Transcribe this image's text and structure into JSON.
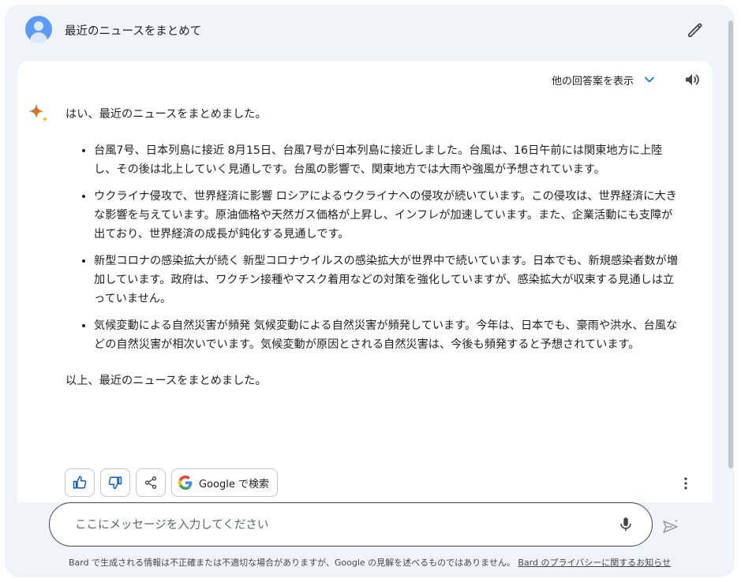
{
  "query": {
    "text": "最近のニュースをまとめて"
  },
  "response": {
    "drafts_label": "他の回答案を表示",
    "intro": "はい、最近のニュースをまとめました。",
    "bullets": [
      "台風7号、日本列島に接近 8月15日、台風7号が日本列島に接近しました。台風は、16日午前には関東地方に上陸し、その後は北上していく見通しです。台風の影響で、関東地方では大雨や強風が予想されています。",
      "ウクライナ侵攻で、世界経済に影響 ロシアによるウクライナへの侵攻が続いています。この侵攻は、世界経済に大きな影響を与えています。原油価格や天然ガス価格が上昇し、インフレが加速しています。また、企業活動にも支障が出ており、世界経済の成長が鈍化する見通しです。",
      "新型コロナの感染拡大が続く 新型コロナウイルスの感染拡大が世界中で続いています。日本でも、新規感染者数が増加しています。政府は、ワクチン接種やマスク着用などの対策を強化していますが、感染拡大が収束する見通しは立っていません。",
      "気候変動による自然災害が頻発 気候変動による自然災害が頻発しています。今年は、日本でも、豪雨や洪水、台風などの自然災害が相次いでいます。気候変動が原因とされる自然災害は、今後も頻発すると予想されています。"
    ],
    "closing": "以上、最近のニュースをまとめました。",
    "google_button": "Google で検索"
  },
  "input": {
    "placeholder": "ここにメッセージを入力してください",
    "value": ""
  },
  "footer": {
    "disclaimer": "Bard で生成される情報は不正確または不適切な場合がありますが、Google の見解を述べるものではありません。",
    "privacy_link": "Bard のプライバシーに関するお知らせ"
  },
  "icons": {
    "avatar": "user-avatar-icon",
    "edit": "pencil-icon",
    "expand": "chevron-down-icon",
    "speaker": "speaker-icon",
    "sparkle": "bard-sparkle-icon",
    "like": "thumbs-up-icon",
    "dislike": "thumbs-down-icon",
    "share": "share-icon",
    "google": "google-g-icon",
    "more": "more-vert-icon",
    "mic": "microphone-icon",
    "send": "send-icon"
  },
  "colors": {
    "frame_bg": "#f0f4f9",
    "accent_blue": "#1a73e8",
    "avatar_blue": "#5b9bf5",
    "text": "#1f1f1f"
  }
}
